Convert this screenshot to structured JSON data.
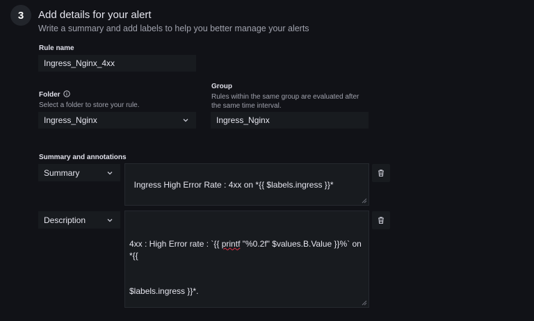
{
  "section": {
    "step": "3",
    "title": "Add details for your alert",
    "subtitle": "Write a summary and add labels to help you better manage your alerts"
  },
  "rule_name": {
    "label": "Rule name",
    "value": "Ingress_Nginx_4xx"
  },
  "folder": {
    "label": "Folder",
    "description": "Select a folder to store your rule.",
    "value": "Ingress_Nginx"
  },
  "group": {
    "label": "Group",
    "description_line1": "Rules within the same group are evaluated after",
    "description_line2": "the same time interval.",
    "value": "Ingress_Nginx"
  },
  "annotations": {
    "label": "Summary and annotations",
    "items": [
      {
        "key": "Summary",
        "value": "Ingress High Error Rate : 4xx on *{{ $labels.ingress }}*"
      },
      {
        "key": "Description",
        "value_part1": "4xx : High Error rate : `{{ ",
        "value_spell": "printf",
        "value_part2": " \"%0.2f\" $values.B.Value }}%` on *{{",
        "value_line2": "$labels.ingress }}*."
      }
    ]
  },
  "icons": {
    "info": "info-circle-icon",
    "chevron": "chevron-down-icon",
    "delete": "trash-icon"
  }
}
